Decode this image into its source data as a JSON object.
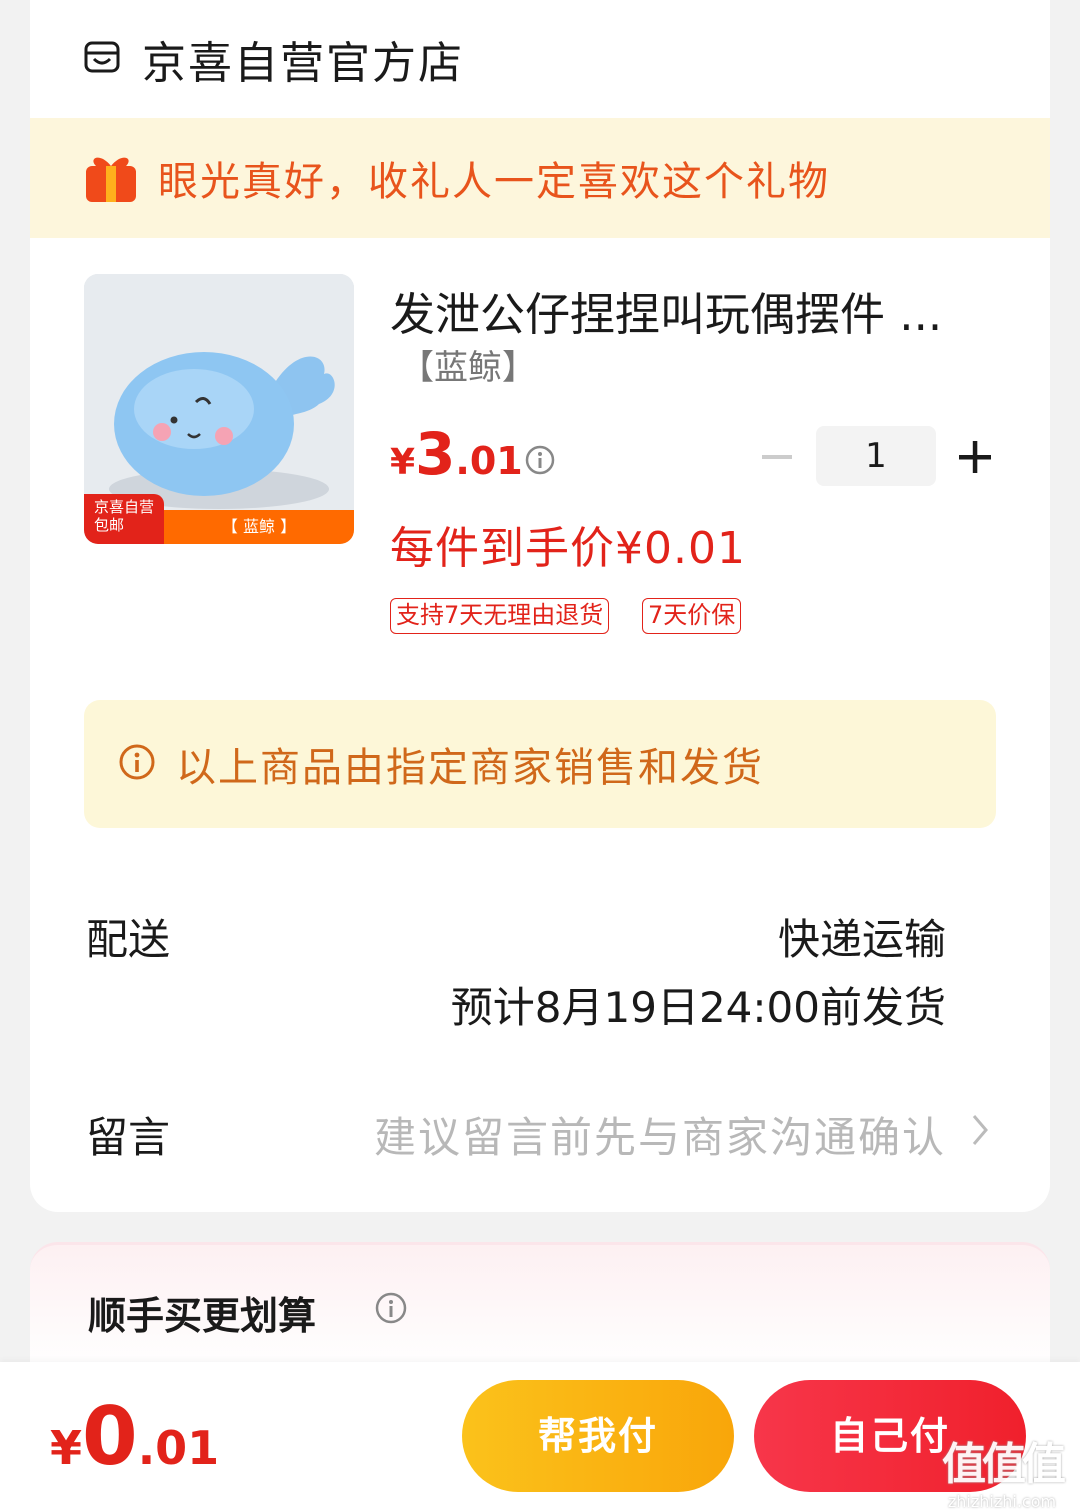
{
  "shop": {
    "name": "京喜自营官方店",
    "icon": "shop-icon"
  },
  "gift_banner": {
    "text": "眼光真好，收礼人一定喜欢这个礼物",
    "icon": "gift-icon"
  },
  "product": {
    "title": "发泄公仔捏捏叫玩偶摆件 ...",
    "variant": "【蓝鲸】",
    "image_badge": [
      "京喜自营",
      "包邮"
    ],
    "image_strip": "【 蓝鲸 】",
    "price": {
      "currency": "¥",
      "integer": "3",
      "decimal": ".01"
    },
    "final_price": "每件到手价¥0.01",
    "tags": [
      "支持7天无理由退货",
      "7天价保"
    ],
    "quantity": "1"
  },
  "notice": {
    "text": "以上商品由指定商家销售和发货"
  },
  "delivery": {
    "label": "配送",
    "method": "快递运输",
    "eta": "预计8月19日24:00前发货"
  },
  "message": {
    "label": "留言",
    "placeholder": "建议留言前先与商家沟通确认"
  },
  "upsell": {
    "title": "顺手买更划算"
  },
  "bottom": {
    "total": {
      "currency": "¥",
      "integer": "0",
      "decimal": ".01"
    },
    "help_pay": "帮我付",
    "self_pay": "自己付"
  },
  "watermark": {
    "logo": "值值值",
    "url": "zhizhizhi.com"
  },
  "colors": {
    "accent_red": "#e2231a",
    "banner_orange": "#e8541c",
    "help_btn": "#fbc21b",
    "notice_bg": "#fdf7d8"
  }
}
